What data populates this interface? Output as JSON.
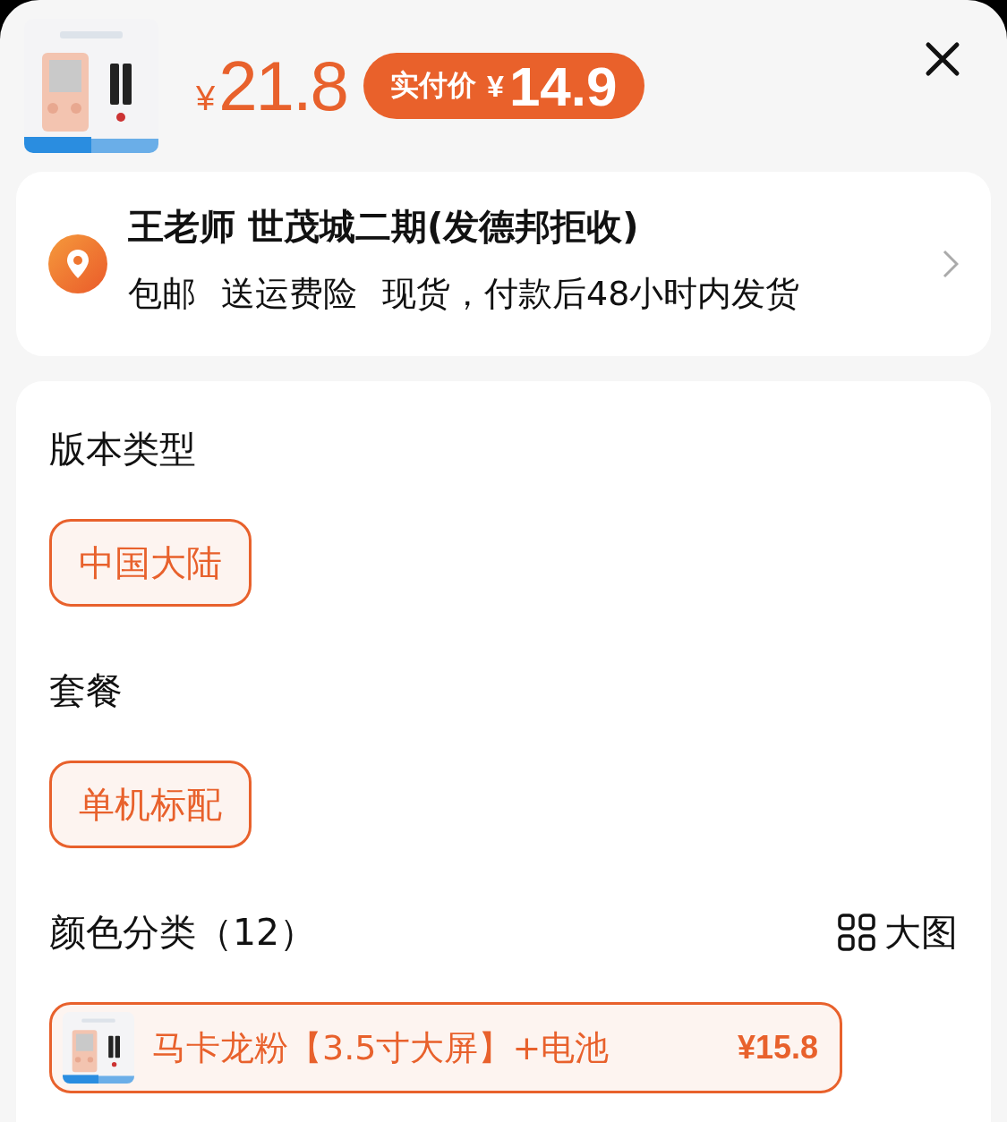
{
  "header": {
    "price_symbol": "¥",
    "price": "21.8",
    "final_price": {
      "label": "实付价",
      "symbol": "¥",
      "value": "14.9"
    }
  },
  "address": {
    "title": "王老师 世茂城二期(发德邦拒收)",
    "services": [
      "包邮",
      "送运费险",
      "现货，付款后48小时内发货"
    ]
  },
  "sections": [
    {
      "kind": "chips",
      "title": "版本类型",
      "options": [
        {
          "label": "中国大陆",
          "selected": true
        }
      ]
    },
    {
      "kind": "chips",
      "title": "套餐",
      "options": [
        {
          "label": "单机标配",
          "selected": true
        }
      ]
    },
    {
      "kind": "swatches",
      "title": "颜色分类（12）",
      "view_toggle": "大图",
      "options": [
        {
          "label": "马卡龙粉【3.5寸大屏】+电池",
          "price": "¥15.8",
          "selected": true
        }
      ]
    }
  ]
}
